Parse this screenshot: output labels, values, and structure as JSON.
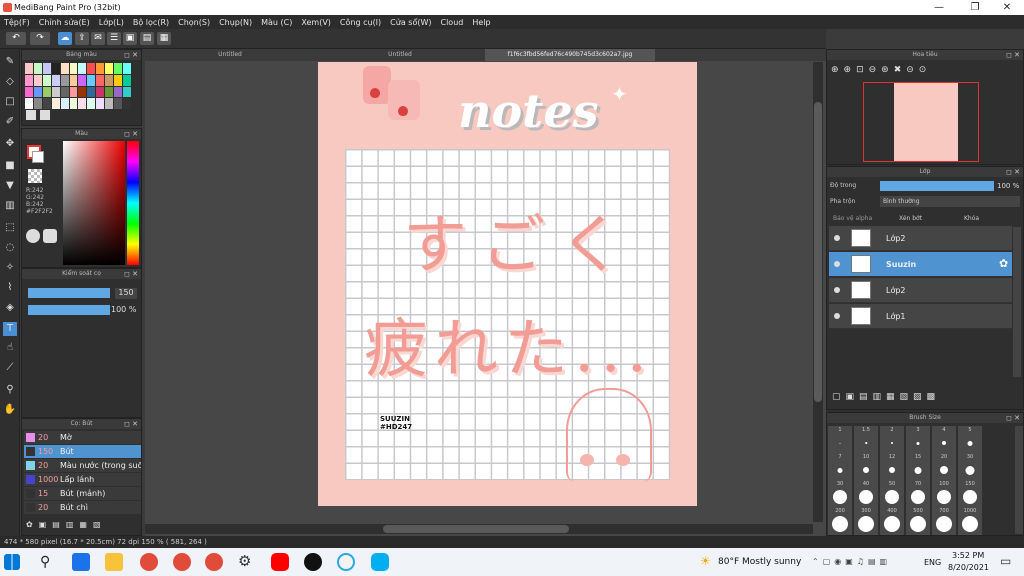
{
  "window": {
    "title": "MediBang Paint Pro (32bit)",
    "minimize": "—",
    "maximize": "❐",
    "close": "✕"
  },
  "menu": [
    "Tệp(F)",
    "Chỉnh sửa(E)",
    "Lớp(L)",
    "Bộ lọc(R)",
    "Chọn(S)",
    "Chụp(N)",
    "Màu (C)",
    "Xem(V)",
    "Công cụ(I)",
    "Cửa sổ(W)",
    "Cloud",
    "Help"
  ],
  "tabs": [
    "Untitled",
    "Untitled",
    "f1f6c3fbd56fed76c490b745d3c602a7.jpg"
  ],
  "palette": {
    "title": "Bảng màu"
  },
  "color": {
    "title": "Màu",
    "r": "R:242",
    "g": "G:242",
    "b": "B:242",
    "hex": "#F2F2F2"
  },
  "brush_control": {
    "title": "Kiểm soát cọ",
    "size": "150",
    "opacity": "100 %"
  },
  "brush_list": {
    "title": "Cọ: Bút",
    "items": [
      {
        "size": "20",
        "name": "Mờ",
        "color": "#e88ee8"
      },
      {
        "size": "150",
        "name": "Bút",
        "color": "#333333"
      },
      {
        "size": "20",
        "name": "Màu nước (trong suốt)",
        "color": "#7fd4e8"
      },
      {
        "size": "1000",
        "name": "Lấp lánh",
        "color": "#4444cc"
      },
      {
        "size": "15",
        "name": "Bút (mảnh)",
        "color": "#333333"
      },
      {
        "size": "20",
        "name": "Bút chì",
        "color": "#333333"
      }
    ]
  },
  "artwork": {
    "title": "notes",
    "line1": "すごく",
    "line2": "疲れた...",
    "sig1": "SUUZIN",
    "sig2": "#HD247"
  },
  "navigator": {
    "title": "Hoa tiêu"
  },
  "layers": {
    "title": "Lớp",
    "opacity_label": "Độ trong",
    "opacity_value": "100 %",
    "blend_label": "Pha trộn",
    "blend_value": "Bình thường",
    "protect_alpha": "Bảo vệ alpha",
    "clipping": "Xén bớt",
    "lock": "Khóa",
    "items": [
      {
        "name": "Lớp2",
        "selected": false
      },
      {
        "name": "Suuzin",
        "selected": true
      },
      {
        "name": "Lớp2",
        "selected": false
      },
      {
        "name": "Lớp1",
        "selected": false
      }
    ]
  },
  "brush_size": {
    "title": "Brush Size",
    "sizes": [
      "1",
      "1.5",
      "2",
      "3",
      "4",
      "5",
      "7",
      "10",
      "12",
      "15",
      "20",
      "30",
      "30",
      "40",
      "50",
      "70",
      "100",
      "150",
      "200",
      "300",
      "400",
      "500",
      "700",
      "1000"
    ]
  },
  "status": {
    "text": "474 * 580 pixel   (16.7 * 20.5cm)   72 dpi   150 %   ( 581, 264 )"
  },
  "taskbar": {
    "weather": "80°F  Mostly sunny",
    "lang": "ENG",
    "time": "3:52 PM",
    "date": "8/20/2021"
  }
}
